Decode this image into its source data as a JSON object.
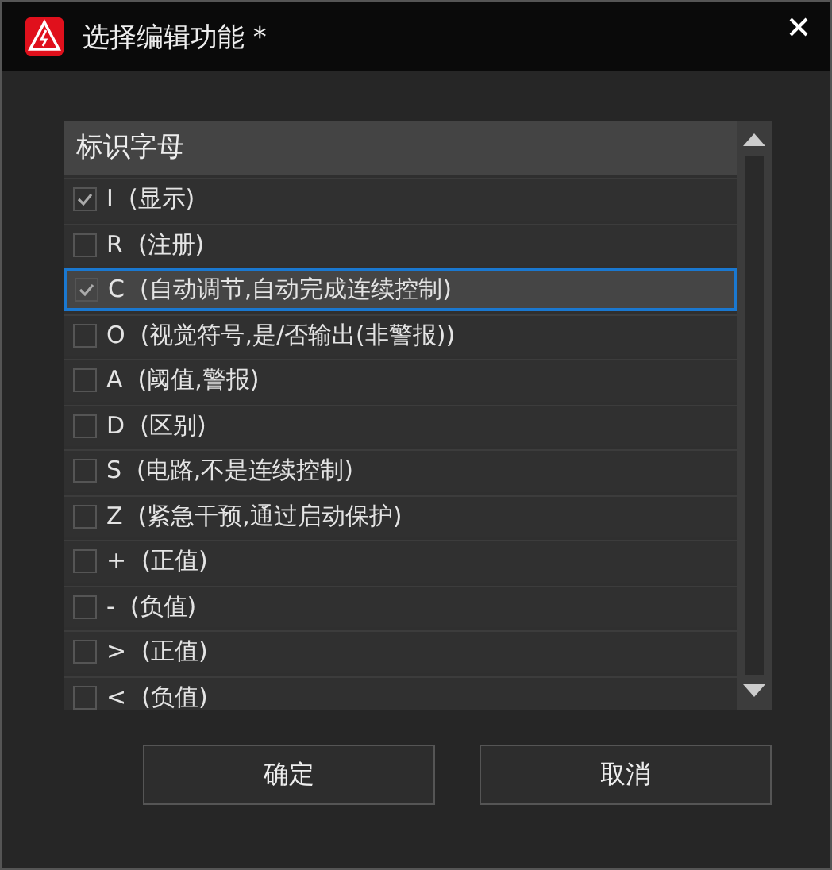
{
  "window": {
    "title": "选择编辑功能 *"
  },
  "list": {
    "header": "标识字母",
    "items": [
      {
        "label": "I  (显示)",
        "checked": true,
        "selected": false
      },
      {
        "label": "R  (注册)",
        "checked": false,
        "selected": false
      },
      {
        "label": "C  (自动调节,自动完成连续控制)",
        "checked": true,
        "selected": true
      },
      {
        "label": "O  (视觉符号,是/否输出(非警报))",
        "checked": false,
        "selected": false
      },
      {
        "label": "A  (阈值,警报)",
        "checked": false,
        "selected": false
      },
      {
        "label": "D  (区别)",
        "checked": false,
        "selected": false
      },
      {
        "label": "S  (电路,不是连续控制)",
        "checked": false,
        "selected": false
      },
      {
        "label": "Z  (紧急干预,通过启动保护)",
        "checked": false,
        "selected": false
      },
      {
        "label": "+  (正值)",
        "checked": false,
        "selected": false
      },
      {
        "label": "-  (负值)",
        "checked": false,
        "selected": false
      },
      {
        "label": ">  (正值)",
        "checked": false,
        "selected": false
      },
      {
        "label": "<  (负值)",
        "checked": false,
        "selected": false
      }
    ]
  },
  "buttons": [
    "确定",
    "取消"
  ]
}
